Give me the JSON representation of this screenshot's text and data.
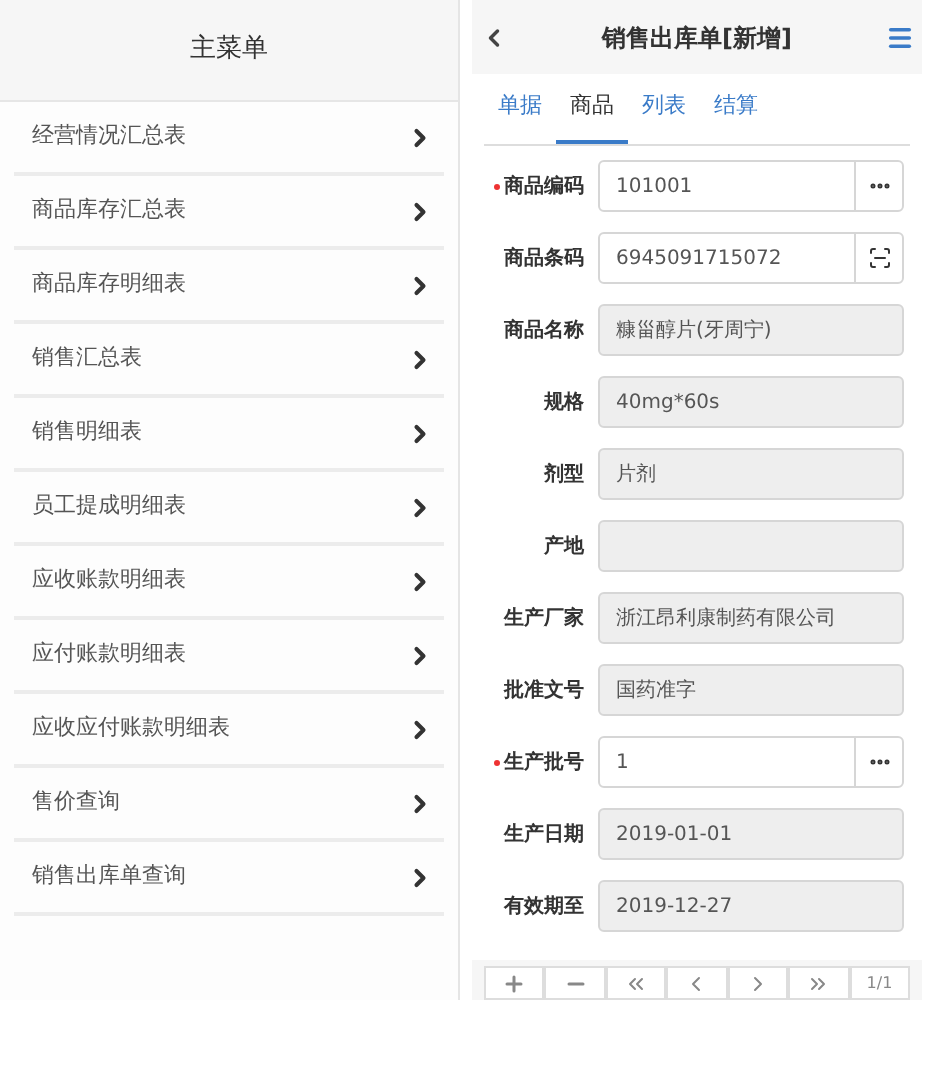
{
  "main_menu": {
    "title": "主菜单",
    "items": [
      {
        "label": "经营情况汇总表"
      },
      {
        "label": "商品库存汇总表"
      },
      {
        "label": "商品库存明细表"
      },
      {
        "label": "销售汇总表"
      },
      {
        "label": "销售明细表"
      },
      {
        "label": "员工提成明细表"
      },
      {
        "label": "应收账款明细表"
      },
      {
        "label": "应付账款明细表"
      },
      {
        "label": "应收应付账款明细表"
      },
      {
        "label": "售价查询"
      },
      {
        "label": "销售出库单查询"
      }
    ]
  },
  "form": {
    "title": "销售出库单[新增]",
    "tabs": [
      {
        "label": "单据",
        "selected": false
      },
      {
        "label": "商品",
        "selected": true
      },
      {
        "label": "列表",
        "selected": false
      },
      {
        "label": "结算",
        "selected": false
      }
    ],
    "fields": [
      {
        "label": "商品编码",
        "value": "101001",
        "required": true,
        "kind": "lookup"
      },
      {
        "label": "商品条码",
        "value": "6945091715072",
        "required": false,
        "kind": "scan"
      },
      {
        "label": "商品名称",
        "value": "糠甾醇片(牙周宁)",
        "required": false,
        "kind": "readonly"
      },
      {
        "label": "规格",
        "value": "40mg*60s",
        "required": false,
        "kind": "readonly"
      },
      {
        "label": "剂型",
        "value": "片剂",
        "required": false,
        "kind": "readonly"
      },
      {
        "label": "产地",
        "required": false,
        "kind": "readonly"
      },
      {
        "label": "生产厂家",
        "value": "浙江昂利康制药有限公司",
        "required": false,
        "kind": "readonly"
      },
      {
        "label": "批准文号",
        "value": "国药准字",
        "required": false,
        "kind": "readonly"
      },
      {
        "label": "生产批号",
        "value": "1",
        "required": true,
        "kind": "lookup"
      },
      {
        "label": "生产日期",
        "value": "2019-01-01",
        "required": false,
        "kind": "readonly"
      },
      {
        "label": "有效期至",
        "value": "2019-12-27",
        "required": false,
        "kind": "readonly"
      }
    ],
    "toolbar": [
      {
        "kind": "add"
      },
      {
        "kind": "remove"
      },
      {
        "kind": "first"
      },
      {
        "kind": "prev"
      },
      {
        "kind": "next"
      },
      {
        "kind": "last"
      },
      {
        "kind": "page",
        "label": "1/1"
      }
    ]
  }
}
